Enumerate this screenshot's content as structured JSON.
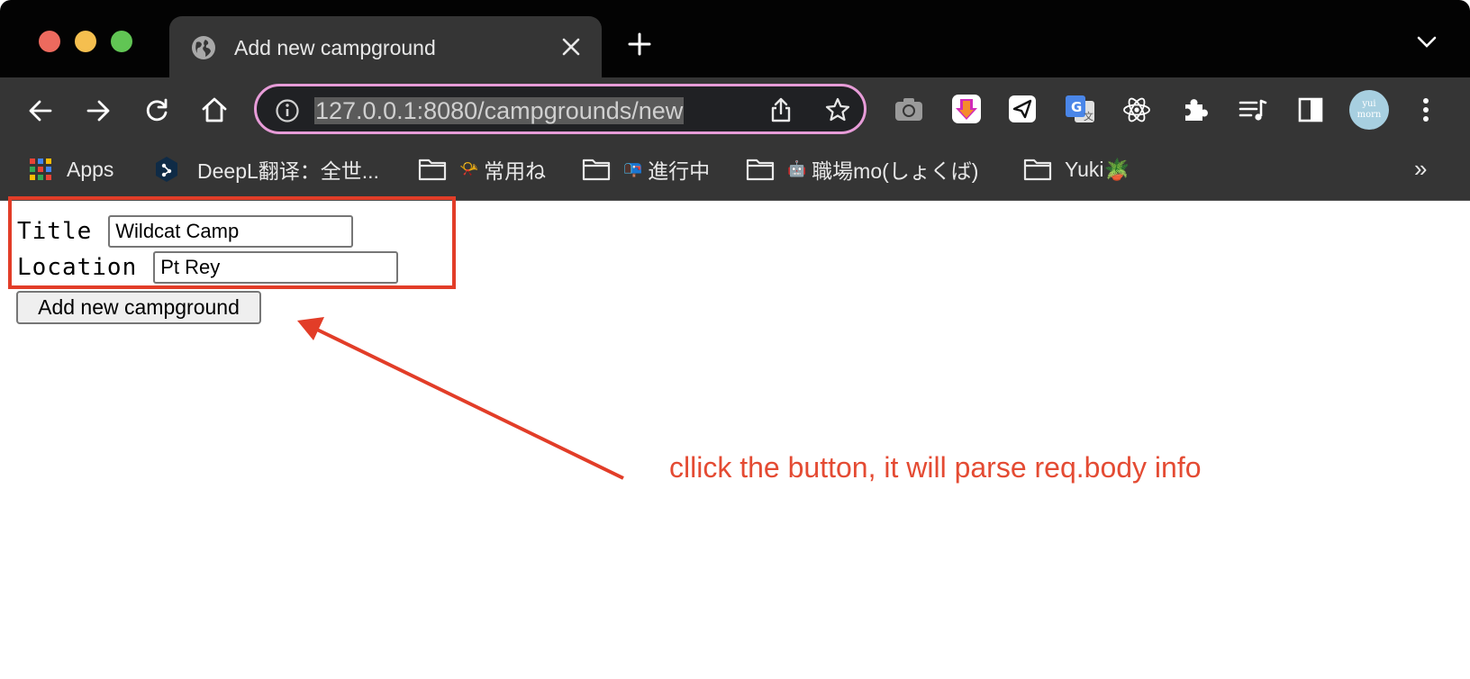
{
  "browser": {
    "tab": {
      "title": "Add new campground",
      "icon": "globe-icon"
    },
    "address_bar": {
      "url": "127.0.0.1:8080/campgrounds/new",
      "border_color": "#e79cd8"
    },
    "avatar_text": "yui\nmorn",
    "bookmarks": [
      {
        "label": "Apps",
        "icon": "apps-grid-icon"
      },
      {
        "label": "DeepL翻译：全世...",
        "icon": "deepl-icon"
      },
      {
        "label": "常用ね",
        "icon": "folder-icon",
        "emoji": "📯"
      },
      {
        "label": "進行中",
        "icon": "folder-icon",
        "emoji": "📭"
      },
      {
        "label": "職場mo(しょくば)",
        "icon": "folder-icon",
        "emoji": "🤖"
      },
      {
        "label": "Yuki🪴",
        "icon": "folder-icon"
      }
    ],
    "more_bookmarks": "»"
  },
  "form": {
    "title_label": "Title",
    "title_value": "Wildcat Camp",
    "location_label": "Location",
    "location_value": "Pt Rey",
    "submit_label": "Add new campground"
  },
  "annotation": {
    "text": "cllick the button, it will parse req.body info",
    "color": "#e44b33"
  }
}
